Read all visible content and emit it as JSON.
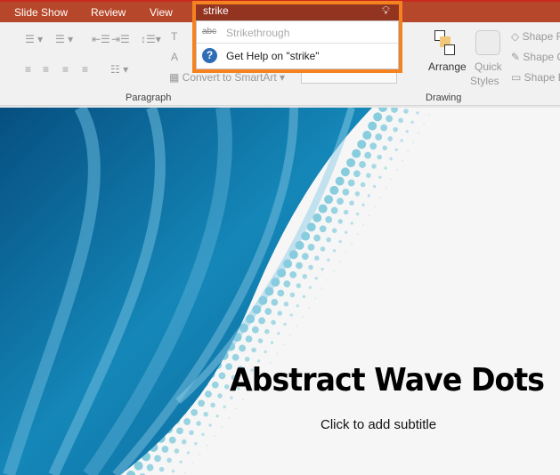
{
  "tabs": [
    "Slide Show",
    "Review",
    "View"
  ],
  "search": {
    "value": "strike",
    "icon": "lightbulb-icon"
  },
  "suggestions": [
    {
      "label": "Strikethrough",
      "icon": "strikethrough-icon",
      "glyph": "abc"
    },
    {
      "label": "Get Help on \"strike\"",
      "icon": "help-icon",
      "glyph": "?"
    }
  ],
  "ribbon": {
    "paragraph_group": "Paragraph",
    "drawing_group": "Drawing",
    "convert_smartart": "Convert to SmartArt",
    "text_dir": "T",
    "align": "A",
    "arrange": "Arrange",
    "quick_styles_1": "Quick",
    "quick_styles_2": "Styles",
    "shape_fill": "Shape F",
    "shape_outline": "Shape O",
    "shape_effects": "Shape E"
  },
  "slide": {
    "title": "Abstract Wave Dots",
    "subtitle": "Click to add subtitle"
  },
  "colors": {
    "titlebar": "#b7472a",
    "highlight": "#f58220",
    "search": "#933421",
    "wave": "#0a6fa3"
  }
}
